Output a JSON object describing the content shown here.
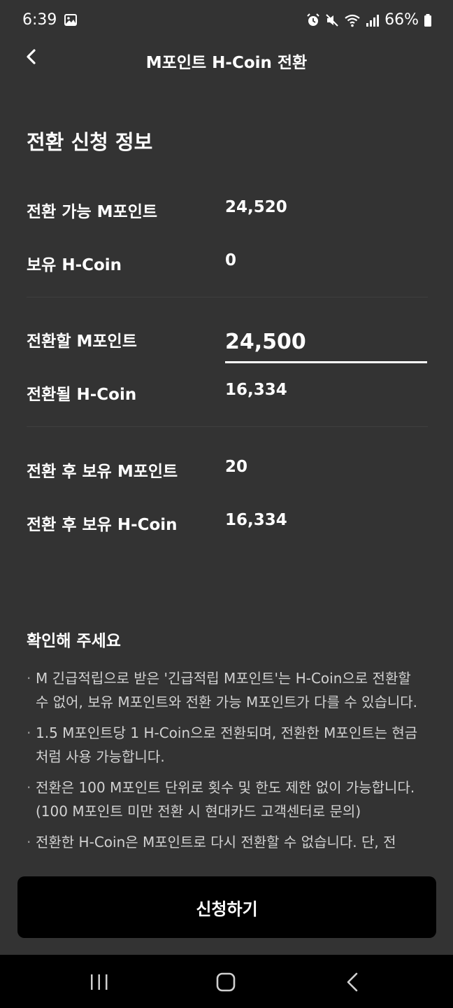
{
  "status_bar": {
    "time": "6:39",
    "battery": "66%"
  },
  "header": {
    "title": "M포인트 H-Coin 전환"
  },
  "info": {
    "section_title": "전환 신청 정보",
    "available_points_label": "전환 가능 M포인트",
    "available_points_value": "24,520",
    "owned_hcoin_label": "보유 H-Coin",
    "owned_hcoin_value": "0",
    "convert_points_label": "전환할 M포인트",
    "convert_points_value": "24,500",
    "converted_hcoin_label": "전환될 H-Coin",
    "converted_hcoin_value": "16,334",
    "after_points_label": "전환 후 보유 M포인트",
    "after_points_value": "20",
    "after_hcoin_label": "전환 후 보유 H-Coin",
    "after_hcoin_value": "16,334"
  },
  "notice": {
    "title": "확인해 주세요",
    "items": [
      "M 긴급적립으로 받은 '긴급적립 M포인트'는 H-Coin으로 전환할 수 없어, 보유 M포인트와 전환 가능 M포인트가 다를 수 있습니다.",
      "1.5 M포인트당 1 H-Coin으로 전환되며, 전환한 M포인트는 현금처럼 사용 가능합니다.",
      "전환은 100 M포인트 단위로 횟수 및 한도 제한 없이 가능합니다.(100 M포인트 미만 전환 시 현대카드 고객센터로 문의)",
      "전환한 H-Coin은 M포인트로 다시 전환할 수 없습니다. 단, 전"
    ]
  },
  "submit_label": "신청하기",
  "colors": {
    "background": "#333333",
    "button": "#000000",
    "text": "#ffffff",
    "notice_text": "#d2d2d2"
  }
}
